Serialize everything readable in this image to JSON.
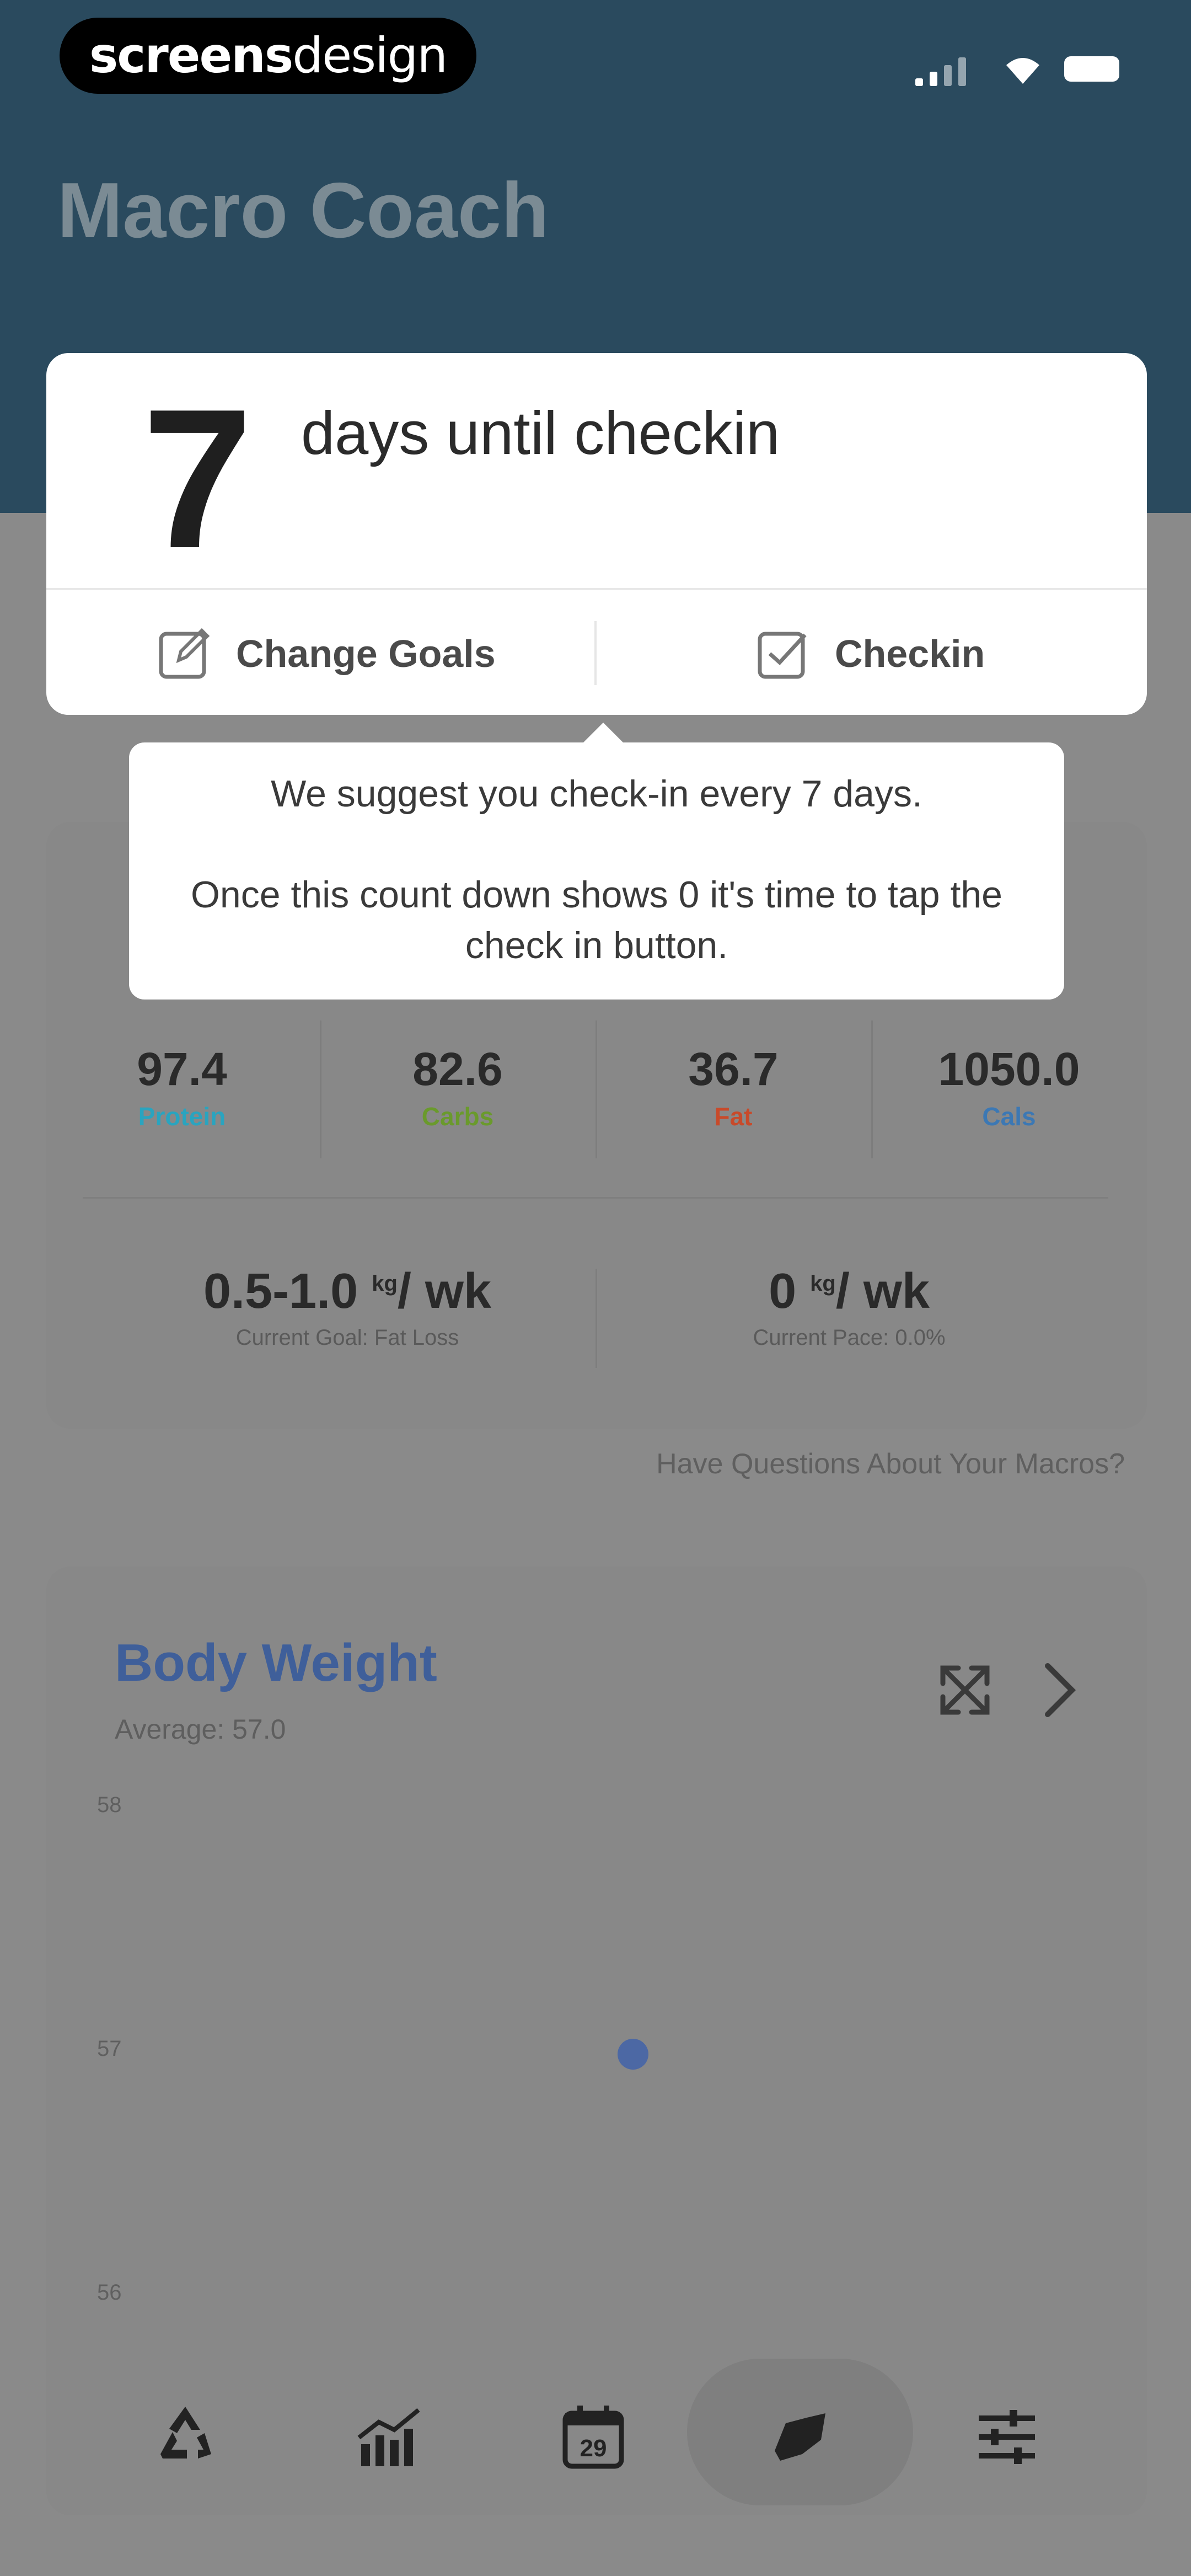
{
  "status_bar": {
    "brand_prefix": "screens",
    "brand_suffix": "design"
  },
  "header": {
    "title": "Macro Coach"
  },
  "checkin_card": {
    "count": "7",
    "count_label": "days until checkin",
    "change_goals_label": "Change Goals",
    "checkin_label": "Checkin"
  },
  "tooltip": {
    "line1": "We suggest you check-in every 7 days.",
    "line2": "Once this count down shows 0 it's time to tap the check in button."
  },
  "macros": [
    {
      "value": "97.4",
      "label": "Protein",
      "color": "#2aa4bf"
    },
    {
      "value": "82.6",
      "label": "Carbs",
      "color": "#6a9a2c"
    },
    {
      "value": "36.7",
      "label": "Fat",
      "color": "#c84a2a"
    },
    {
      "value": "1050.0",
      "label": "Cals",
      "color": "#3c78b4"
    }
  ],
  "goals": {
    "rate_value": "0.5-1.0",
    "rate_unit_sup": "kg",
    "rate_unit": "/ wk",
    "rate_label": "Current Goal: Fat Loss",
    "pace_value": "0",
    "pace_unit_sup": "kg",
    "pace_unit": "/ wk",
    "pace_label": "Current Pace: 0.0%"
  },
  "questions_link": "Have Questions About Your Macros?",
  "body_weight": {
    "title": "Body Weight",
    "subtitle": "Average: 57.0",
    "accent": "#3f5f9a",
    "y_ticks": [
      "58",
      "57",
      "56"
    ]
  },
  "chart_data": {
    "type": "scatter",
    "title": "Body Weight",
    "subtitle": "Average: 57.0",
    "y_ticks": [
      58,
      57,
      56
    ],
    "ylim": [
      56,
      58
    ],
    "series": [
      {
        "values": [
          57
        ]
      }
    ]
  },
  "tabs": [
    {
      "name": "recycle-icon"
    },
    {
      "name": "stats-icon"
    },
    {
      "name": "calendar-icon",
      "text": "29"
    },
    {
      "name": "workout-icon",
      "active": true
    },
    {
      "name": "sliders-icon"
    }
  ]
}
